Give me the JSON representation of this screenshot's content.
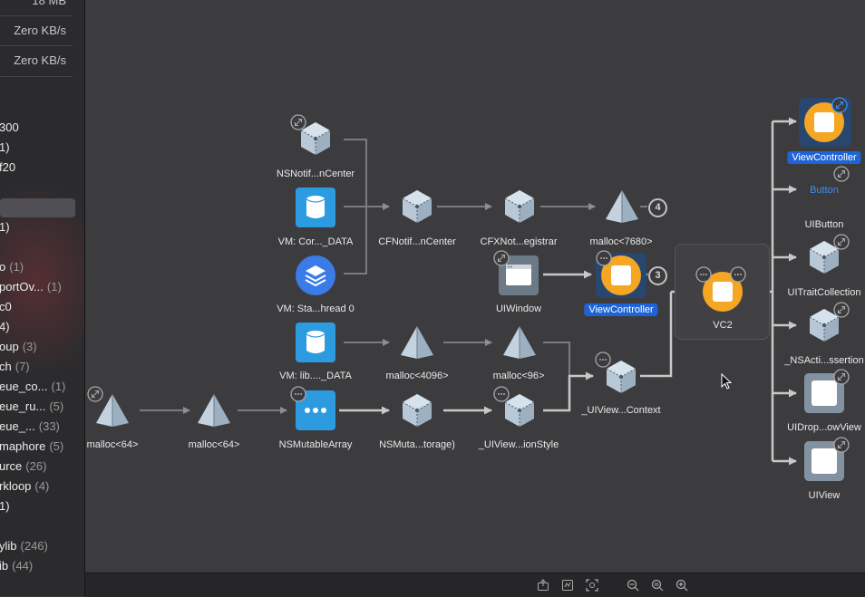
{
  "sidebar": {
    "stats": [
      "18 MB",
      "Zero KB/s",
      "Zero KB/s"
    ],
    "items": [
      {
        "name": "300",
        "count": ""
      },
      {
        "name": "1)",
        "count": ""
      },
      {
        "name": "f20",
        "count": ""
      },
      {
        "name": "",
        "count": ""
      },
      {
        "name": "1)",
        "count": ""
      },
      {
        "name": "o",
        "count": "(1)"
      },
      {
        "name": "portOv...",
        "count": "(1)"
      },
      {
        "name": "c0",
        "count": ""
      },
      {
        "name": "4)",
        "count": ""
      },
      {
        "name": "oup",
        "count": "(3)"
      },
      {
        "name": "ch",
        "count": "(7)"
      },
      {
        "name": "eue_co...",
        "count": "(1)"
      },
      {
        "name": "eue_ru...",
        "count": "(5)"
      },
      {
        "name": "eue_...",
        "count": "(33)"
      },
      {
        "name": "maphore",
        "count": "(5)"
      },
      {
        "name": "urce",
        "count": "(26)"
      },
      {
        "name": "rkloop",
        "count": "(4)"
      },
      {
        "name": "1)",
        "count": ""
      },
      {
        "name": "ylib",
        "count": "(246)"
      },
      {
        "name": "ib",
        "count": "(44)"
      }
    ]
  },
  "graph": {
    "nodes": {
      "nsnotif": "NSNotif...nCenter",
      "vm_core": "VM: Cor..._DATA",
      "vm_stack": "VM: Sta...hread 0",
      "cfnotif": "CFNotif...nCenter",
      "cfxnot": "CFXNot...egistrar",
      "malloc7680": "malloc<7680>",
      "uiwindow": "UIWindow",
      "viewcontroller_mid": "ViewController",
      "vm_lib": "VM: lib...._DATA",
      "malloc4096": "malloc<4096>",
      "malloc96": "malloc<96>",
      "uiview_context": "_UIView...Context",
      "malloc64_a": "malloc<64>",
      "malloc64_b": "malloc<64>",
      "nsmutablearray": "NSMutableArray",
      "nsmuta_storage": "NSMuta...torage)",
      "uiview_ionstyle": "_UIView...ionStyle",
      "vc2": "VC2",
      "viewcontroller_top": "ViewController",
      "button": "Button",
      "uibutton": "UIButton",
      "uitraitcollection": "UITraitCollection",
      "nsacti": "_NSActi...ssertion",
      "uidrop": "UIDrop...owView",
      "uiview": "UIView"
    },
    "badges": {
      "b4": "4",
      "b3": "3"
    }
  },
  "colors": {
    "canvas": "#3c3c3e",
    "sidebar": "#2b2b2d",
    "selection": "#1f64d6",
    "objc_node": "#f5a623",
    "vm_node": "#2d9be0",
    "edge": "#8e8e90"
  },
  "toolbar": {
    "buttons": [
      "export-graph-icon",
      "memory-graph-icon",
      "focus-icon",
      "zoom-out-icon",
      "zoom-actual-icon",
      "zoom-in-icon"
    ]
  }
}
